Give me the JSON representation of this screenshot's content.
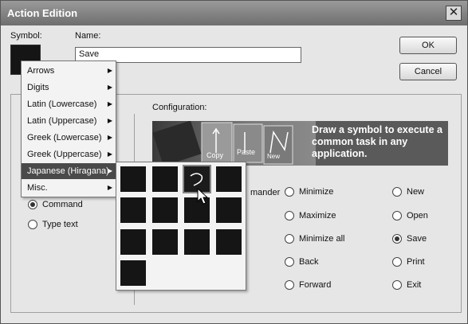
{
  "window": {
    "title": "Action Edition",
    "close_glyph": "✕"
  },
  "form": {
    "symbol_label": "Symbol:",
    "name_label": "Name:",
    "name_value": "Save"
  },
  "buttons": {
    "ok": "OK",
    "cancel": "Cancel"
  },
  "config": {
    "label": "Configuration:",
    "banner_text": "Draw a symbol to execute a common task in any application.",
    "banner_words": [
      "Copy",
      "Paste",
      "New"
    ]
  },
  "left_options": {
    "commander_fragment": "mander",
    "command": "Command",
    "type_text": "Type text",
    "selected": "Command"
  },
  "col1": [
    "Minimize",
    "Maximize",
    "Minimize all",
    "Back",
    "Forward"
  ],
  "col2": [
    "New",
    "Open",
    "Save",
    "Print",
    "Exit"
  ],
  "selected_action": "Save",
  "menu": {
    "items": [
      "Arrows",
      "Digits",
      "Latin (Lowercase)",
      "Latin (Uppercase)",
      "Greek (Lowercase)",
      "Greek (Uppercase)",
      "Japanese (Hiragana)",
      "Misc."
    ],
    "highlighted": "Japanese (Hiragana)"
  },
  "symbol_grid": {
    "count": 13,
    "selected_index": 2
  },
  "colors": {
    "titlebar": "#7a7a7a",
    "menu_highlight": "#4a4a4a",
    "swatch": "#151515"
  }
}
